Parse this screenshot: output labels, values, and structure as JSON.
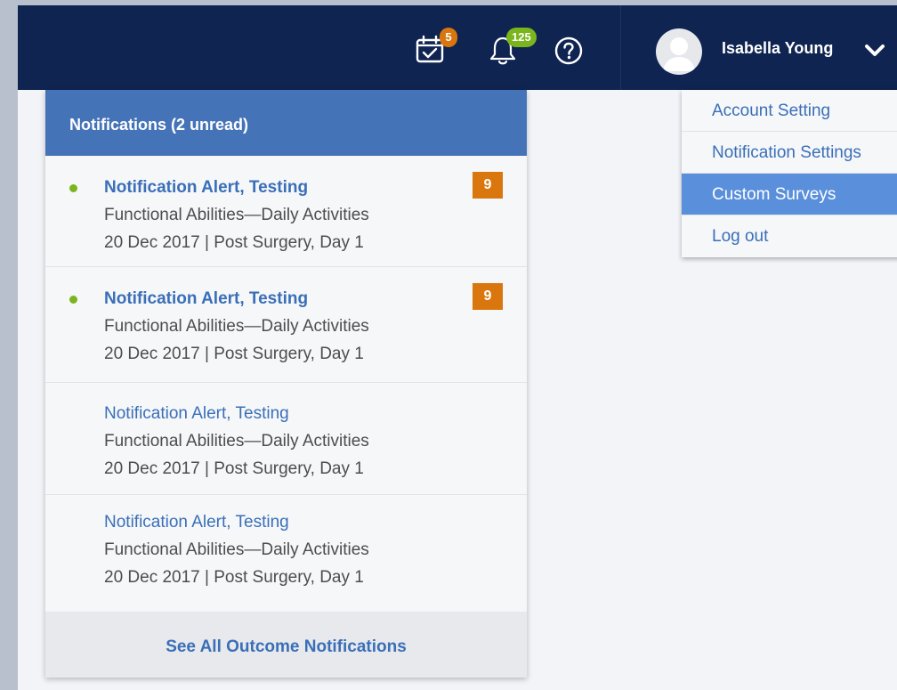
{
  "topbar": {
    "calendar_badge": "5",
    "bell_badge": "125",
    "user_name": "Isabella Young"
  },
  "notifications": {
    "header": "Notifications (2 unread)",
    "items": [
      {
        "title": "Notification Alert, Testing",
        "line1": "Functional Abilities—Daily Activities",
        "line2": "20 Dec 2017 | Post Surgery, Day 1",
        "count": "9",
        "unread": true
      },
      {
        "title": "Notification Alert, Testing",
        "line1": "Functional Abilities—Daily Activities",
        "line2": "20 Dec 2017 | Post Surgery, Day 1",
        "count": "9",
        "unread": true
      },
      {
        "title": "Notification Alert, Testing",
        "line1": "Functional Abilities—Daily Activities",
        "line2": "20 Dec 2017 | Post Surgery, Day 1",
        "count": "",
        "unread": false
      },
      {
        "title": "Notification Alert, Testing",
        "line1": "Functional Abilities—Daily Activities",
        "line2": "20 Dec 2017 | Post Surgery, Day 1",
        "count": "",
        "unread": false
      }
    ],
    "footer": "See All Outcome Notifications"
  },
  "account_menu": {
    "items": [
      "Account Setting",
      "Notification Settings",
      "Custom Surveys",
      "Log out"
    ],
    "active": "Custom Surveys"
  },
  "colors": {
    "topbar": "#0f2451",
    "header": "#4573b8",
    "link": "#3a6fb8",
    "orange_badge": "#d9770e",
    "green_badge": "#7ab51d",
    "menu_active": "#5a8fdb"
  },
  "icons": [
    "calendar-check-icon",
    "bell-icon",
    "help-icon",
    "avatar",
    "chevron-down-icon"
  ]
}
